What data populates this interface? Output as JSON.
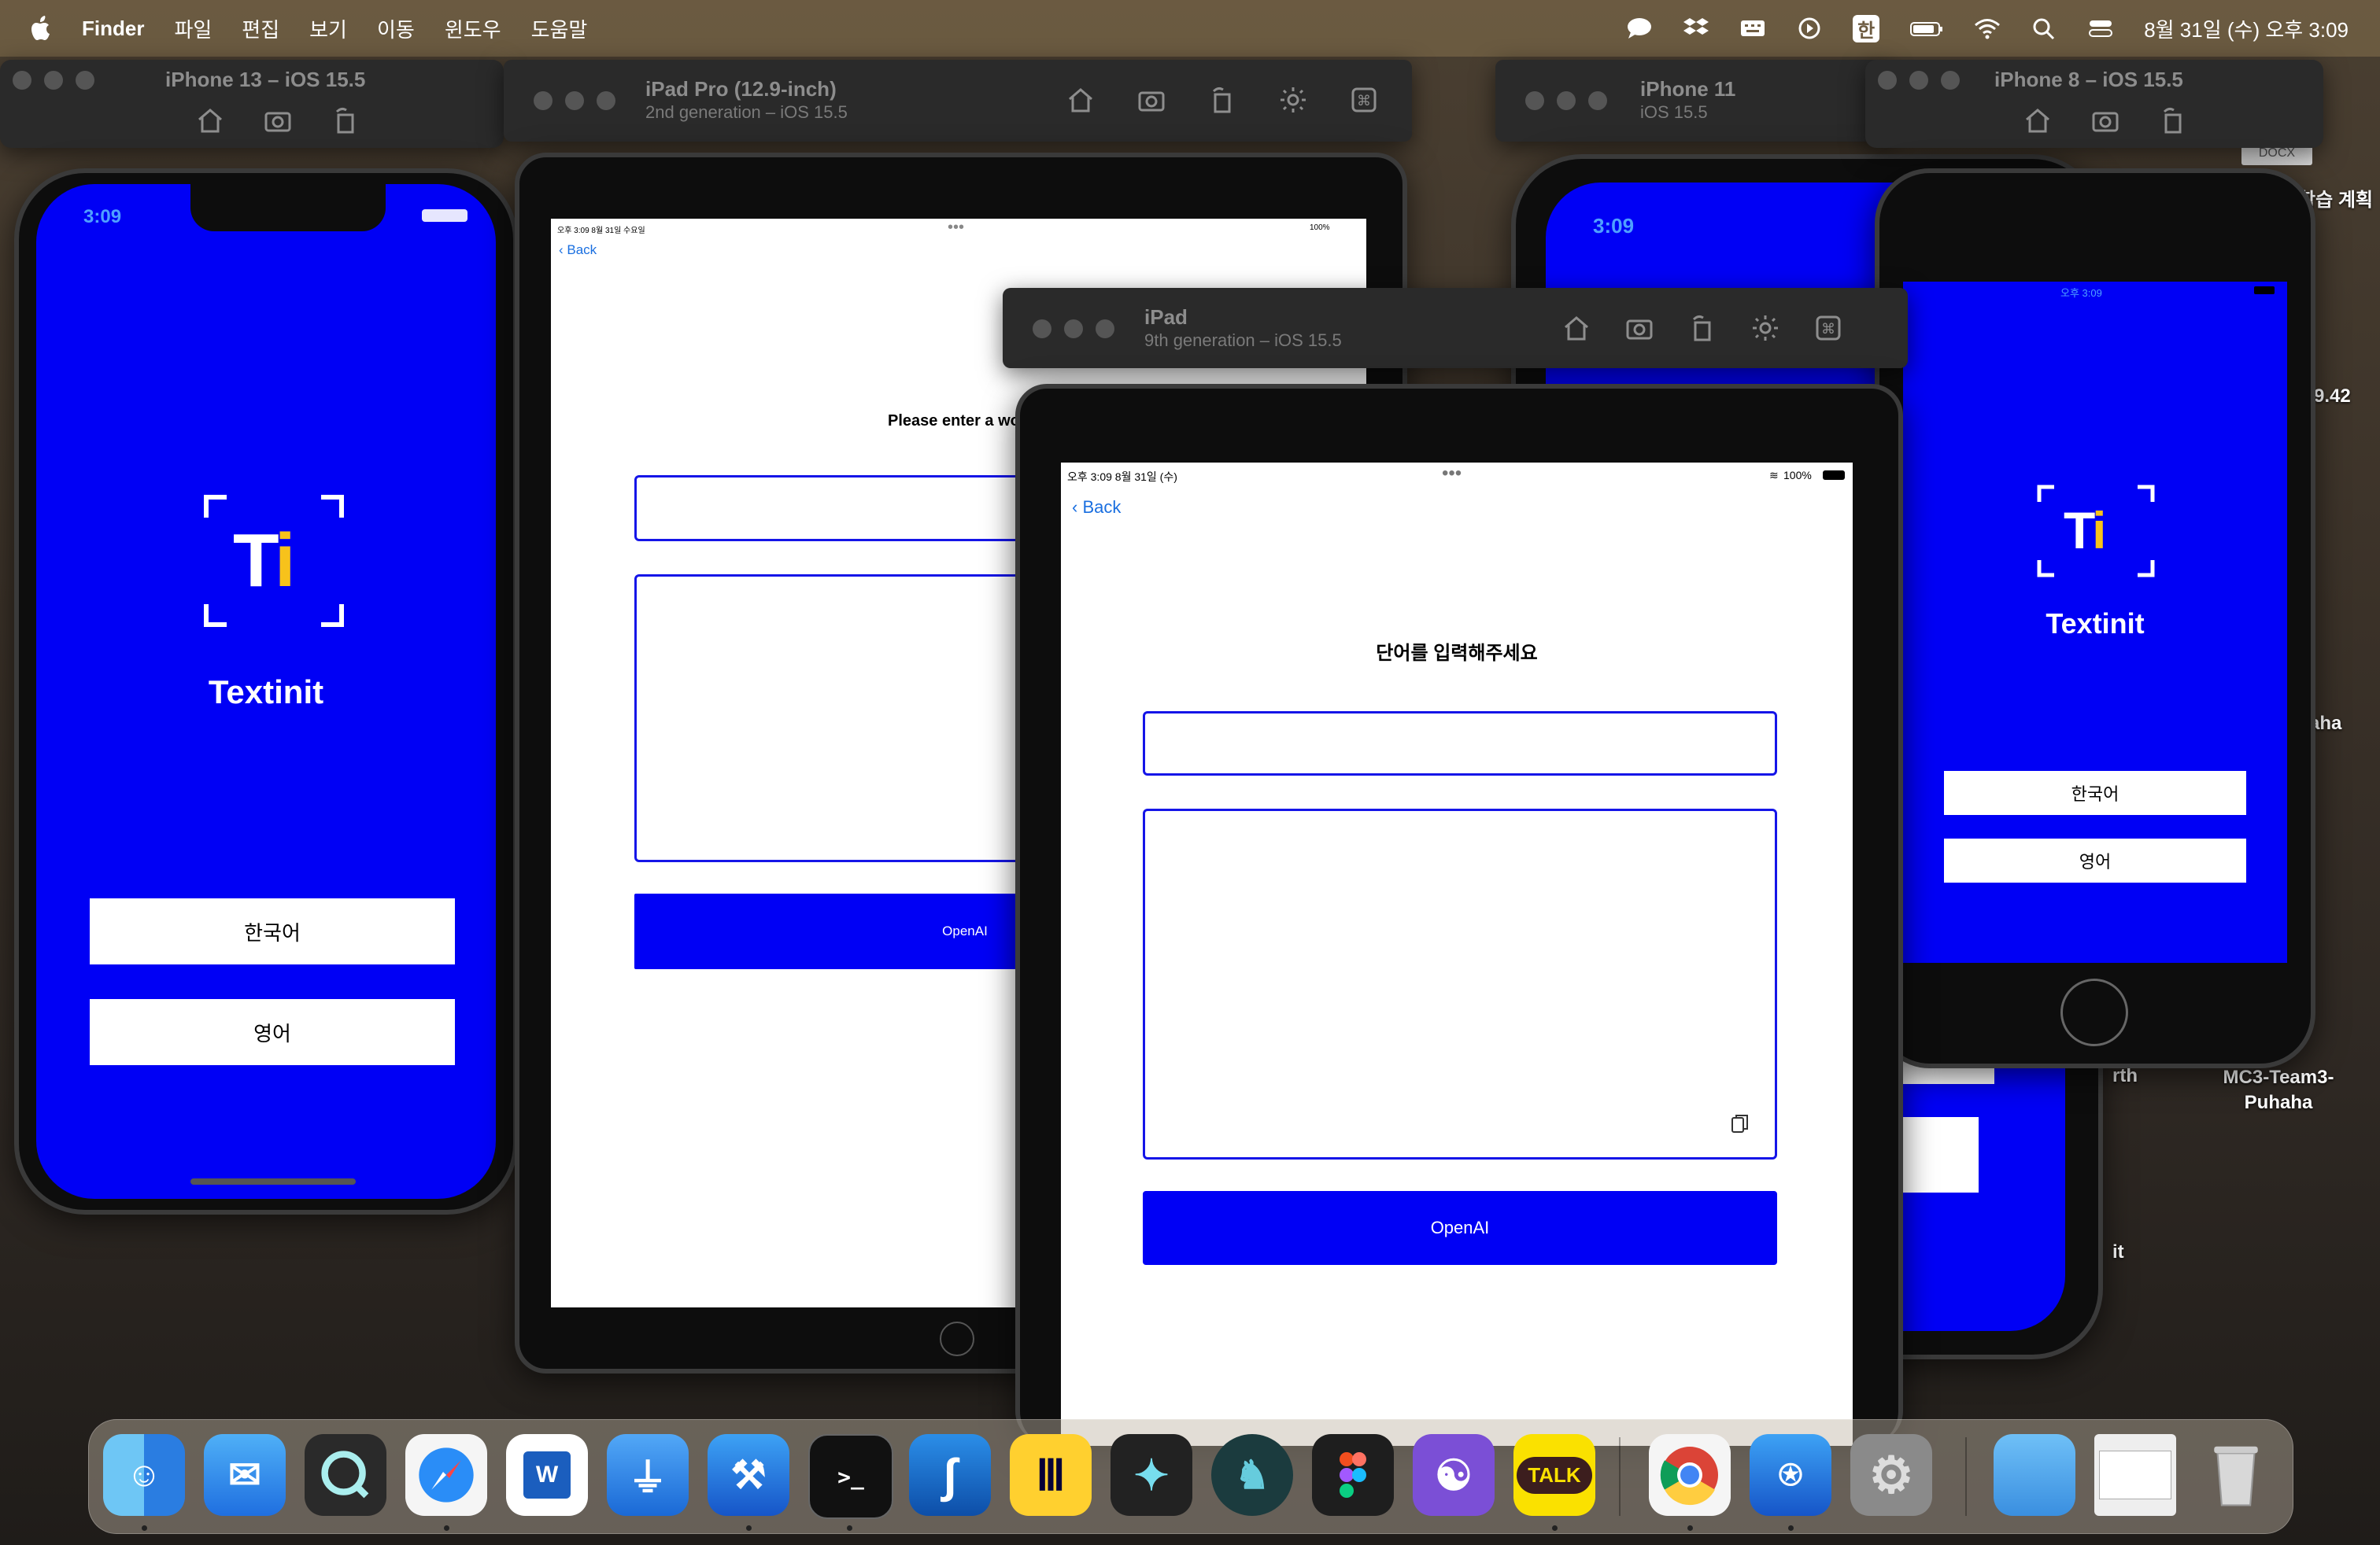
{
  "menubar": {
    "app": "Finder",
    "items": [
      "파일",
      "편집",
      "보기",
      "이동",
      "윈도우",
      "도움말"
    ],
    "input_mode": "한",
    "clock": "8월 31일 (수) 오후 3:09"
  },
  "sim_iphone13": {
    "title": "iPhone 13 – iOS 15.5",
    "status_time": "3:09",
    "logo_text": "Ti",
    "app_name": "Textinit",
    "btn_korean": "한국어",
    "btn_english": "영어"
  },
  "sim_ipadpro": {
    "title": "iPad Pro (12.9-inch)",
    "subtitle": "2nd generation – iOS 15.5",
    "status_left": "오후 3:09  8월 31일 수요일",
    "battery": "100%",
    "back": "Back",
    "prompt": "Please enter a wo",
    "submit": "OpenAI"
  },
  "sim_iphone11": {
    "title": "iPhone 11",
    "subtitle": "iOS 15.5",
    "status_time": "3:09"
  },
  "sim_iphone8": {
    "title": "iPhone 8 – iOS 15.5",
    "status_center": "오후 3:09",
    "logo_text": "Ti",
    "app_name": "Textinit",
    "btn_korean": "한국어",
    "btn_english": "영어"
  },
  "sim_ipad9": {
    "title": "iPad",
    "subtitle": "9th generation – iOS 15.5",
    "status_left": "오후 3:09   8월 31일 (수)",
    "battery": "100%",
    "back": "Back",
    "prompt": "단어를 입력해주세요",
    "submit": "OpenAI"
  },
  "desktop": {
    "docx": "DOCX",
    "label_plan": "학습 계획",
    "label_942": "9.42",
    "label_aha": "aha",
    "label_rth": "rth",
    "label_it": "it",
    "folder_name": "MC3-Team3-Puhaha"
  },
  "dock": {
    "talk": "TALK"
  },
  "colors": {
    "app_blue": "#0000f5",
    "accent_link": "#1a6fe0"
  }
}
